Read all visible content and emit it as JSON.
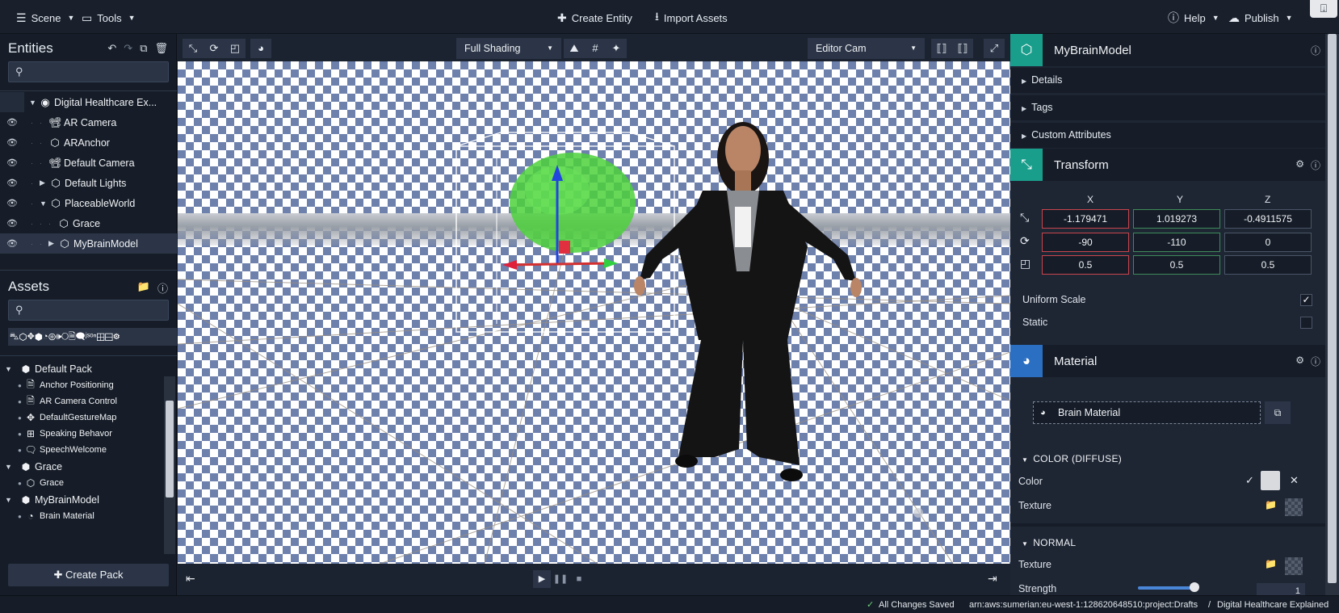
{
  "topbar": {
    "scene_label": "Scene",
    "tools_label": "Tools",
    "create_entity_label": "Create Entity",
    "import_assets_label": "Import Assets",
    "help_label": "Help",
    "publish_label": "Publish"
  },
  "entities": {
    "title": "Entities",
    "search_placeholder": "",
    "items": [
      {
        "label": "Digital Healthcare Ex..."
      },
      {
        "label": "AR Camera"
      },
      {
        "label": "ARAnchor"
      },
      {
        "label": "Default Camera"
      },
      {
        "label": "Default Lights"
      },
      {
        "label": "PlaceableWorld"
      },
      {
        "label": "Grace"
      },
      {
        "label": "MyBrainModel"
      }
    ]
  },
  "assets": {
    "title": "Assets",
    "search_placeholder": "",
    "filter_icons": "⛍⬡✥⬢◔⊛🕪🞅🗎🗨ʲˢᵒⁿ⊞⊟⚙",
    "tree": [
      {
        "label": "Default Pack"
      },
      {
        "label": "Anchor Positioning"
      },
      {
        "label": "AR Camera Control"
      },
      {
        "label": "DefaultGestureMap"
      },
      {
        "label": "Speaking Behavor"
      },
      {
        "label": "SpeechWelcome"
      },
      {
        "label": "Grace"
      },
      {
        "label": "Grace"
      },
      {
        "label": "MyBrainModel"
      },
      {
        "label": "Brain Material"
      }
    ],
    "create_pack_label": "Create Pack"
  },
  "viewport": {
    "shading_value": "Full Shading",
    "camera_value": "Editor Cam"
  },
  "inspector": {
    "entity_name": "MyBrainModel",
    "sections": {
      "details": "Details",
      "tags": "Tags",
      "custom_attributes": "Custom Attributes"
    },
    "transform": {
      "title": "Transform",
      "axis_x": "X",
      "axis_y": "Y",
      "axis_z": "Z",
      "translation": [
        "-1.179471",
        "1.019273",
        "-0.4911575"
      ],
      "rotation": [
        "-90",
        "-110",
        "0"
      ],
      "scale": [
        "0.5",
        "0.5",
        "0.5"
      ],
      "uniform_scale_label": "Uniform Scale",
      "uniform_scale_checked": true,
      "static_label": "Static",
      "static_checked": false
    },
    "material": {
      "title": "Material",
      "material_name": "Brain Material",
      "color_diffuse_label": "COLOR (DIFFUSE)",
      "color_label": "Color",
      "color_value": "#d9dadd",
      "texture_label": "Texture",
      "normal_label": "NORMAL",
      "normal_texture_label": "Texture",
      "strength_label": "Strength",
      "strength_value": "1"
    }
  },
  "statusbar": {
    "saved_text": "All Changes Saved",
    "project_path": "arn:aws:sumerian:eu-west-1:128620648510:project:Drafts",
    "separator": "/",
    "scene_name": "Digital Healthcare Explained"
  },
  "colors": {
    "transform_badge": "#1a9e8c",
    "entity_badge": "#1a9e8c",
    "material_badge": "#2a6fc2",
    "x_field_border": "#c8454d",
    "y_field_border": "#3e8a5a"
  }
}
